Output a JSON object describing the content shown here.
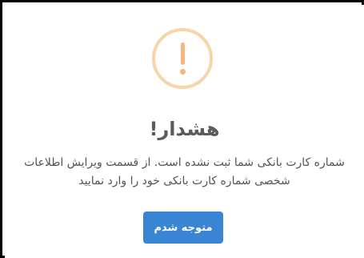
{
  "dialog": {
    "icon": "warning-icon",
    "icon_color": "#f6b57d",
    "icon_ring_color": "#f8d4a9",
    "title": "!هشدار",
    "message": "شماره کارت بانکی شما ثبت نشده است. از قسمت ویرایش اطلاعات شخصی شماره کارت بانکی خود را وارد نمایید",
    "confirm_label": "متوجه شدم",
    "confirm_color": "#3a84d4"
  }
}
